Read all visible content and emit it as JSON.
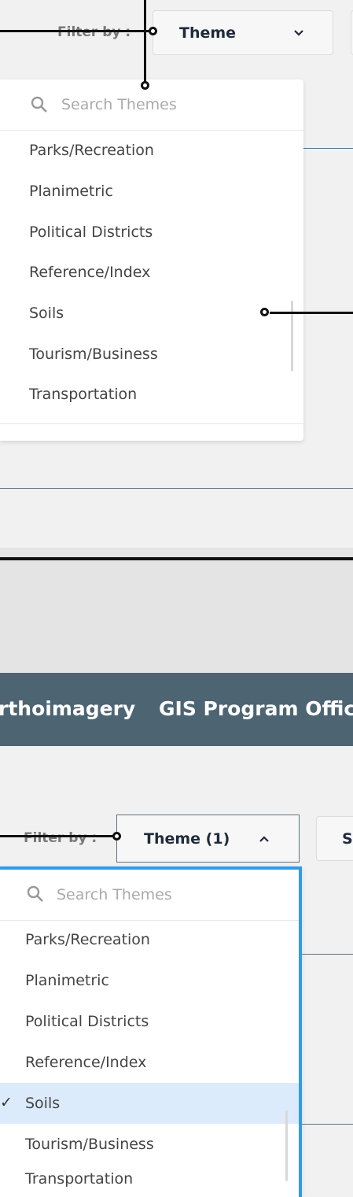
{
  "top_panel": {
    "filter_label": "Filter by :",
    "theme_button_label": "Theme",
    "search_placeholder": "Search Themes",
    "options": [
      "Parks/Recreation",
      "Planimetric",
      "Political Districts",
      "Reference/Index",
      "Soils",
      "Tourism/Business",
      "Transportation"
    ]
  },
  "navbar": {
    "items": [
      "rthoimagery",
      "GIS Program Offic"
    ]
  },
  "bottom_panel": {
    "filter_label": "Filter by :",
    "theme_button_label": "Theme (1)",
    "side_button_label": "S",
    "search_placeholder": "Search Themes",
    "options": [
      "Parks/Recreation",
      "Planimetric",
      "Political Districts",
      "Reference/Index",
      "Soils",
      "Tourism/Business",
      "Transportation"
    ],
    "selected_option": "Soils",
    "selected_mark": "✓"
  },
  "colors": {
    "navbar": "#4d6473",
    "selected_bg": "#dcebfb",
    "focus_border": "#2f9be8"
  }
}
